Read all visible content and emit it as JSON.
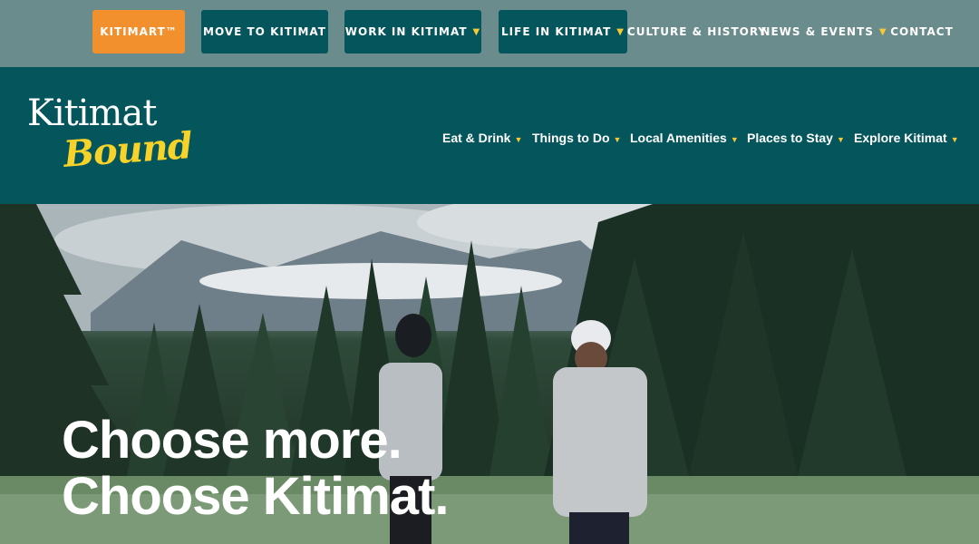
{
  "topnav": {
    "kitimart": "KITIMART™",
    "move": "MOVE TO KITIMAT",
    "work": "WORK IN KITIMAT",
    "life": "LIFE IN KITIMAT",
    "culture": "CULTURE & HISTORY",
    "news": "NEWS & EVENTS",
    "contact": "CONTACT"
  },
  "logo": {
    "line1": "Kitimat",
    "line2": "Bound"
  },
  "mainnav": {
    "eat": "Eat & Drink",
    "things": "Things to Do",
    "amenities": "Local Amenities",
    "stay": "Places to Stay",
    "explore": "Explore Kitimat"
  },
  "hero": {
    "line1": "Choose more.",
    "line2": "Choose Kitimat."
  },
  "colors": {
    "topbar": "#6b8c8c",
    "header": "#05565c",
    "accent_orange": "#f3902e",
    "accent_yellow": "#f7c934"
  },
  "icons": {
    "dropdown": "chevron-down-icon"
  }
}
